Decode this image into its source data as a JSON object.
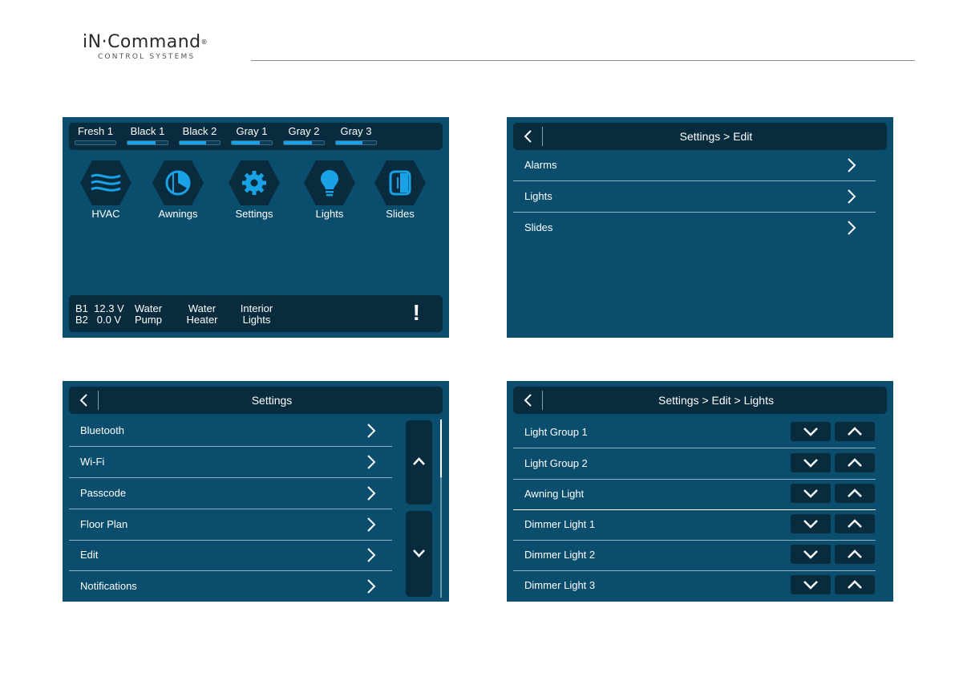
{
  "brand": {
    "name": "iN·Command",
    "registered": "®",
    "subtitle": "CONTROL SYSTEMS"
  },
  "colors": {
    "screen_bg": "#0a4d6d",
    "bar_bg": "#082b3d",
    "accent": "#19a3e6",
    "text": "#ffffff"
  },
  "home": {
    "tanks": [
      {
        "label": "Fresh 1",
        "level": 0.0
      },
      {
        "label": "Black 1",
        "level": 0.7
      },
      {
        "label": "Black 2",
        "level": 0.65
      },
      {
        "label": "Gray 1",
        "level": 0.7
      },
      {
        "label": "Gray 2",
        "level": 0.7
      },
      {
        "label": "Gray 3",
        "level": 0.65
      }
    ],
    "apps": [
      {
        "label": "HVAC",
        "icon": "hvac-icon"
      },
      {
        "label": "Awnings",
        "icon": "awning-icon"
      },
      {
        "label": "Settings",
        "icon": "gear-icon"
      },
      {
        "label": "Lights",
        "icon": "lightbulb-icon"
      },
      {
        "label": "Slides",
        "icon": "slide-icon"
      }
    ],
    "battery": {
      "b1": "B1  12.3 V",
      "b2": "B2   0.0 V"
    },
    "quick": [
      {
        "line1": "Water",
        "line2": "Pump"
      },
      {
        "line1": "Water",
        "line2": "Heater"
      },
      {
        "line1": "Interior",
        "line2": "Lights"
      }
    ],
    "alert": "!"
  },
  "edit": {
    "title": "Settings > Edit",
    "items": [
      "Alarms",
      "Lights",
      "Slides"
    ]
  },
  "settings": {
    "title": "Settings",
    "items": [
      "Bluetooth",
      "Wi-Fi",
      "Passcode",
      "Floor Plan",
      "Edit",
      "Notifications"
    ]
  },
  "lights": {
    "title": "Settings > Edit > Lights",
    "items": [
      "Light Group 1",
      "Light Group 2",
      "Awning Light",
      "Dimmer Light 1",
      "Dimmer Light 2",
      "Dimmer Light 3"
    ]
  }
}
